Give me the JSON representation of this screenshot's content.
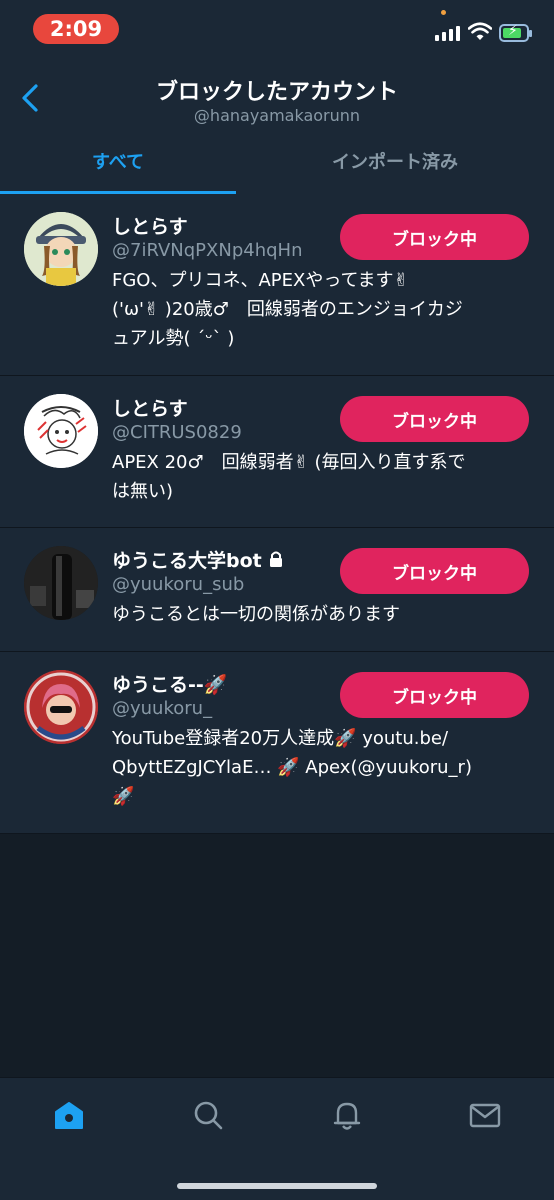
{
  "status": {
    "time": "2:09"
  },
  "header": {
    "title": "ブロックしたアカウント",
    "subtitle": "@hanayamakaorunn",
    "tabs": [
      {
        "label": "すべて",
        "active": true
      },
      {
        "label": "インポート済み",
        "active": false
      }
    ]
  },
  "accounts": [
    {
      "name": "しとらす",
      "handle": "@7iRVNqPXNp4hqHn",
      "bio_lines": [
        "FGO、プリコネ、APEXやってます✌",
        "('ω'✌ )20歳♂　回線弱者のエンジョイカジ",
        "ュアル勢( ´ᵕ` )"
      ],
      "button": "ブロック中"
    },
    {
      "name": "しとらす",
      "handle": "@CITRUS0829",
      "bio_lines": [
        "APEX 20♂　回線弱者✌ (毎回入り直す系で",
        "は無い)"
      ],
      "button": "ブロック中"
    },
    {
      "name": "ゆうこる大学bot",
      "handle": "@yuukoru_sub",
      "bio_lines": [
        "ゆうこるとは一切の関係があります"
      ],
      "button": "ブロック中"
    },
    {
      "name": "ゆうこる--🚀",
      "handle": "@yuukoru_",
      "bio_lines": [
        "YouTube登録者20万人達成🚀 youtu.be/",
        "QbyttEZgJCYlaE… 🚀 Apex(@yuukoru_r)",
        "🚀"
      ],
      "button": "ブロック中"
    }
  ],
  "colors": {
    "accent": "#1da1f2",
    "block_button": "#e0245e",
    "background": "#141d26",
    "surface": "#1b2836",
    "secondary_text": "#8899a6"
  },
  "tabbar": [
    "home-icon",
    "search-icon",
    "notifications-icon",
    "messages-icon"
  ]
}
